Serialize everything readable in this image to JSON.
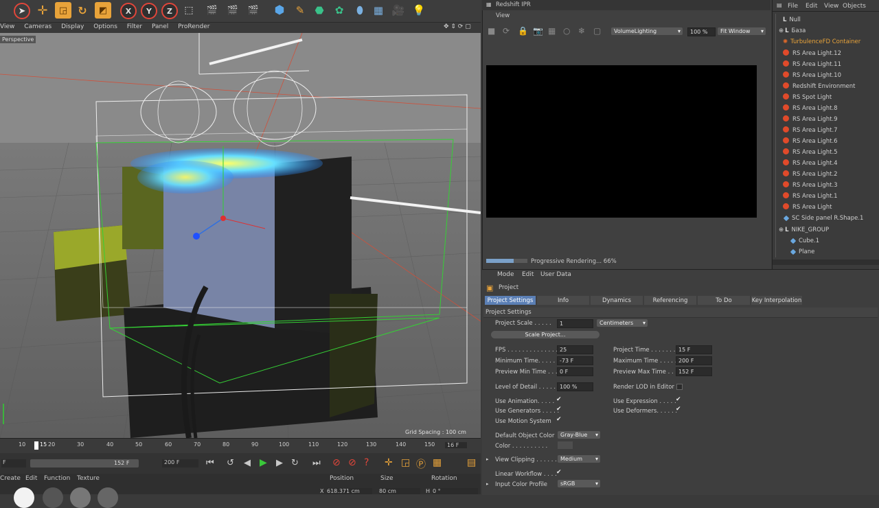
{
  "viewport_menu": [
    "View",
    "Cameras",
    "Display",
    "Options",
    "Filter",
    "Panel",
    "ProRender"
  ],
  "viewport_label": "Perspective",
  "grid_spacing": "Grid Spacing : 100 cm",
  "timeline": {
    "ticks": [
      "10",
      "15",
      "20",
      "30",
      "40",
      "50",
      "60",
      "70",
      "80",
      "90",
      "100",
      "110",
      "120",
      "130",
      "140",
      "150"
    ],
    "current_frame": "16 F",
    "start_field": "F",
    "end_field": "200 F",
    "range_label": "152 F"
  },
  "material_menu": [
    "Create",
    "Edit",
    "Function",
    "Texture"
  ],
  "coords": {
    "position": "Position",
    "size": "Size",
    "rotation": "Rotation",
    "x_label": "X",
    "x_pos": "618.371 cm",
    "x_size": "80 cm",
    "h_label": "H",
    "h_val": "0 °"
  },
  "ipr": {
    "title": "Redshift IPR",
    "view_menu": "View",
    "aov": "VolumeLighting",
    "zoom": "100 %",
    "fit": "Fit Window",
    "status": "Progressive Rendering... 66%"
  },
  "objects": {
    "menu": [
      "File",
      "Edit",
      "View",
      "Objects"
    ],
    "items": [
      {
        "name": "Null",
        "type": "null"
      },
      {
        "name": "База",
        "type": "null"
      },
      {
        "name": "TurbulenceFD Container",
        "type": "tfd"
      },
      {
        "name": "RS Area Light.12",
        "type": "light"
      },
      {
        "name": "RS Area Light.11",
        "type": "light"
      },
      {
        "name": "RS Area Light.10",
        "type": "light"
      },
      {
        "name": "Redshift Environment",
        "type": "light"
      },
      {
        "name": "RS Spot Light",
        "type": "light"
      },
      {
        "name": "RS Area Light.8",
        "type": "light"
      },
      {
        "name": "RS Area Light.9",
        "type": "light"
      },
      {
        "name": "RS Area Light.7",
        "type": "light"
      },
      {
        "name": "RS Area Light.6",
        "type": "light"
      },
      {
        "name": "RS Area Light.5",
        "type": "light"
      },
      {
        "name": "RS Area Light.4",
        "type": "light"
      },
      {
        "name": "RS Area Light.2",
        "type": "light"
      },
      {
        "name": "RS Area Light.3",
        "type": "light"
      },
      {
        "name": "RS Area Light.1",
        "type": "light"
      },
      {
        "name": "RS Area Light",
        "type": "light"
      },
      {
        "name": "SC Side panel R.Shape.1",
        "type": "mesh"
      },
      {
        "name": "NIKE_GROUP",
        "type": "null"
      },
      {
        "name": "Cube.1",
        "type": "mesh"
      },
      {
        "name": "Plane",
        "type": "mesh"
      }
    ]
  },
  "attributes": {
    "menu": [
      "Mode",
      "Edit",
      "User Data"
    ],
    "header": "Project",
    "tabs": [
      "Project Settings",
      "Info",
      "Dynamics",
      "Referencing",
      "To Do",
      "Key Interpolation"
    ],
    "section": "Project Settings",
    "project_scale_label": "Project Scale . . . . .",
    "project_scale": "1",
    "unit": "Centimeters",
    "scale_button": "Scale Project...",
    "fps_label": "FPS . . . . . . . . . . . . . .",
    "fps": "25",
    "project_time_label": "Project Time . . . . . . .",
    "project_time": "15 F",
    "min_time_label": "Minimum Time. . . . . .",
    "min_time": "-73 F",
    "max_time_label": "Maximum Time . . . . .",
    "max_time": "200 F",
    "prev_min_label": "Preview Min Time . . .",
    "prev_min": "0 F",
    "prev_max_label": "Preview Max Time . . .",
    "prev_max": "152 F",
    "lod_label": "Level of Detail . . . . .",
    "lod": "100 %",
    "render_lod_label": "Render LOD in Editor",
    "use_anim": "Use Animation. . . . .",
    "use_expr": "Use Expression . . . . .",
    "use_gen": "Use Generators . . . . .",
    "use_def": "Use Deformers. . . . . .",
    "use_motion": "Use Motion System",
    "def_color_label": "Default Object Color",
    "def_color": "Gray-Blue",
    "color_label": "Color . . . . . . . . . .",
    "clipping_label": "View Clipping . . . . . .",
    "clipping": "Medium",
    "linear_label": "Linear Workflow . . . .",
    "input_profile_label": "Input Color Profile",
    "input_profile": "sRGB"
  }
}
